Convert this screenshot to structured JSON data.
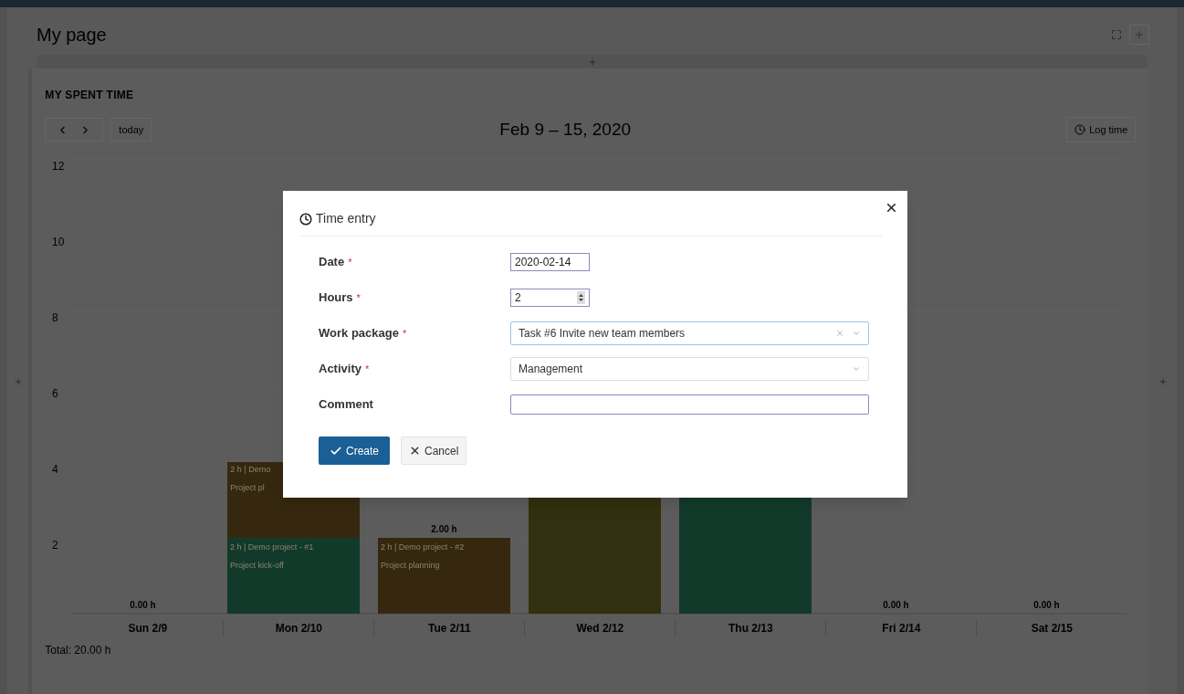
{
  "page": {
    "title": "My page"
  },
  "widget": {
    "title": "MY SPENT TIME",
    "today_button": "today",
    "range": "Feb 9 – 15, 2020",
    "log_time_button": "Log time",
    "chart_data": {
      "type": "bar",
      "categories": [
        "Sun 2/9",
        "Mon 2/10",
        "Tue 2/11",
        "Wed 2/12",
        "Thu 2/13",
        "Fri 2/14",
        "Sat 2/15"
      ],
      "series": [
        {
          "color": "#123a2a",
          "values": [
            0,
            2,
            0,
            null,
            null,
            0,
            0
          ]
        },
        {
          "color": "#36280f",
          "values": [
            0,
            null,
            2,
            null,
            null,
            0,
            0
          ]
        }
      ],
      "ylim": [
        0,
        12
      ],
      "yticks": [
        2,
        4,
        6,
        8,
        10,
        12
      ],
      "value_labels": [
        "0.00 h",
        null,
        "2.00 h",
        null,
        null,
        "0.00 h",
        "0.00 h"
      ]
    },
    "partly_hidden_segment_labels": [
      "2 h | Demo",
      "Project pl"
    ],
    "segment_labels": [
      [
        "2 h | Demo project - #1",
        "Project kick-off"
      ],
      [
        "2 h | Demo project - #2",
        "Project planning"
      ]
    ],
    "total": "Total: 20.00 h"
  },
  "dialog": {
    "title": "Time entry",
    "fields": [
      {
        "kind": "date",
        "label": "Date",
        "marker": "*",
        "value": "2020-02-14"
      },
      {
        "kind": "number",
        "label": "Hours",
        "marker": "*",
        "value": "2"
      },
      {
        "kind": "select",
        "label": "Work package",
        "marker": "*",
        "value": "Task #6 Invite new team members",
        "clearable": true
      },
      {
        "kind": "select",
        "label": "Activity",
        "marker": "*",
        "value": "Management",
        "clearable": false
      },
      {
        "kind": "text",
        "label": "Comment"
      }
    ],
    "buttons": [
      {
        "kind": "primary",
        "label": "Create"
      },
      {
        "kind": "secondary",
        "label": "Cancel"
      }
    ]
  }
}
